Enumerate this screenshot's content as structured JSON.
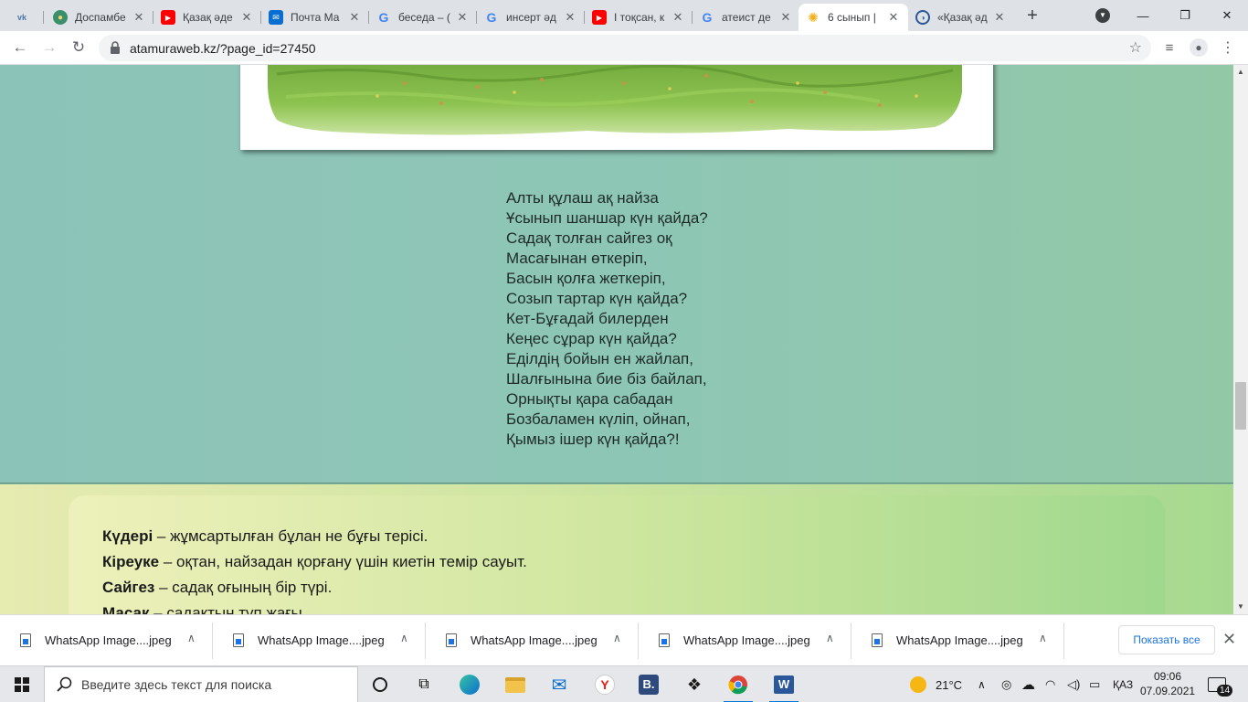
{
  "browser": {
    "tabs": [
      {
        "title": "",
        "icon": "vk-icon"
      },
      {
        "title": "Доспамбе",
        "icon": "site-emblem-icon"
      },
      {
        "title": "Қазақ әде",
        "icon": "youtube-icon"
      },
      {
        "title": "Почта Ма",
        "icon": "mail-icon"
      },
      {
        "title": "беседа – (",
        "icon": "google-icon"
      },
      {
        "title": "инсерт әд",
        "icon": "google-icon"
      },
      {
        "title": "І тоқсан, к",
        "icon": "youtube-icon"
      },
      {
        "title": "атеист де",
        "icon": "google-icon"
      },
      {
        "title": "6 сынып |",
        "icon": "sun-icon",
        "active": true
      },
      {
        "title": "«Қазақ әд",
        "icon": "site-icon"
      }
    ],
    "new_tab": "+",
    "window_controls": {
      "minimize": "—",
      "restore": "❐",
      "close": "✕"
    },
    "url": "atamuraweb.kz/?page_id=27450"
  },
  "page": {
    "poem_lines": [
      "Алты құлаш ақ найза",
      "Ұсынып шаншар күн қайда?",
      "Садақ толған сайгез оқ",
      "Масағынан өткеріп,",
      "Басын қолға жеткеріп,",
      "Созып тартар күн қайда?",
      "Кет-Бұғадай билерден",
      "Кеңес сұрар күн қайда?",
      "Еділдің бойын ен жайлап,",
      "Шалғынына бие біз байлап,",
      "Орнықты қара сабадан",
      "Бозбаламен күліп, ойнап,",
      "Қымыз ішер күн қайда?!"
    ],
    "glossary": [
      {
        "term": "Күдері",
        "definition": " – жұмсартылған бұлан не бұғы терісі."
      },
      {
        "term": "Кіреуке",
        "definition": " – оқтан, найзадан қорғану үшін киетін темір сауыт."
      },
      {
        "term": "Сайгез",
        "definition": " – садақ оғының бір түрі."
      },
      {
        "term": "Масақ",
        "definition": " – садақтың түп жағы."
      }
    ]
  },
  "downloads": {
    "items": [
      "WhatsApp Image....jpeg",
      "WhatsApp Image....jpeg",
      "WhatsApp Image....jpeg",
      "WhatsApp Image....jpeg",
      "WhatsApp Image....jpeg"
    ],
    "show_all": "Показать все"
  },
  "taskbar": {
    "search_placeholder": "Введите здесь текст для поиска",
    "weather": "21°C",
    "language": "ҚАЗ",
    "time": "09:06",
    "date": "07.09.2021",
    "notifications": "14"
  },
  "colors": {
    "poem_band": "#8ec6b6",
    "gloss_band": "#cfe5a2",
    "accent": "#1a73e8"
  }
}
